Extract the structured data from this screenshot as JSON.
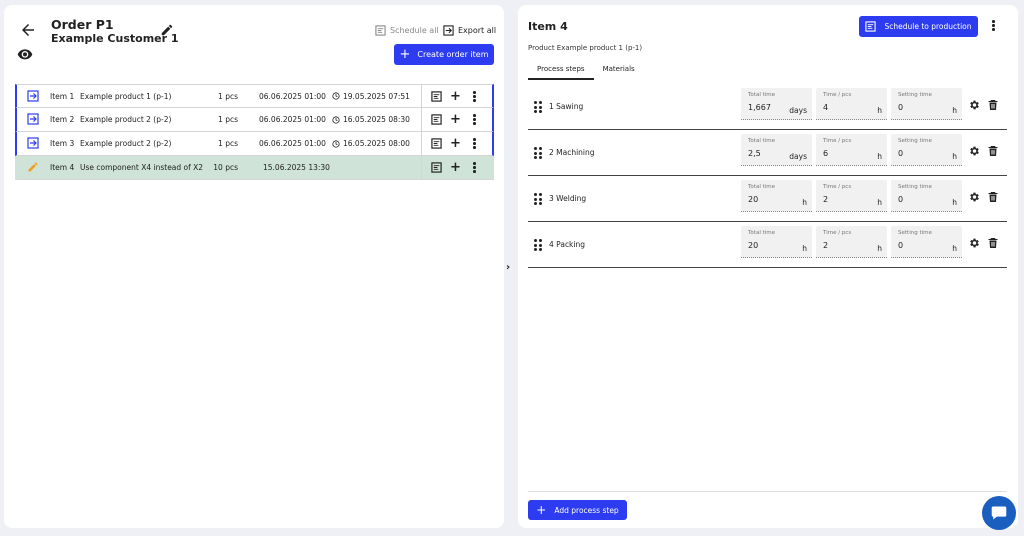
{
  "order": {
    "title": "Order P1",
    "customer": "Example Customer 1",
    "schedule_all_label": "Schedule all",
    "export_all_label": "Export all",
    "create_item_label": "Create order item"
  },
  "items": [
    {
      "name": "Item 1",
      "description": "Example product 1 (p-1)",
      "qty": "1 pcs",
      "date1": "06.06.2025 01:00",
      "date2": "19.05.2025 07:51"
    },
    {
      "name": "Item 2",
      "description": "Example product 2 (p-2)",
      "qty": "1 pcs",
      "date1": "06.06.2025 01:00",
      "date2": "16.05.2025 08:30"
    },
    {
      "name": "Item 3",
      "description": "Example product 2 (p-2)",
      "qty": "1 pcs",
      "date1": "06.06.2025 01:00",
      "date2": "16.05.2025 08:00"
    },
    {
      "name": "Item 4",
      "description": "Use component X4 instead of X2",
      "qty": "10 pcs",
      "date1": "15.06.2025 13:30",
      "date2": ""
    }
  ],
  "detail": {
    "title": "Item 4",
    "schedule_label": "Schedule to production",
    "product_line": "Product Example product 1 (p-1)",
    "tabs": [
      "Process steps",
      "Materials"
    ],
    "field_labels": {
      "total": "Total time",
      "per_pcs": "Time / pcs",
      "setting": "Setting time"
    },
    "steps": [
      {
        "name": "1 Sawing",
        "total": "1,667",
        "total_unit": "days",
        "per_pcs": "4",
        "per_pcs_unit": "h",
        "setting": "0",
        "setting_unit": "h"
      },
      {
        "name": "2 Machining",
        "total": "2,5",
        "total_unit": "days",
        "per_pcs": "6",
        "per_pcs_unit": "h",
        "setting": "0",
        "setting_unit": "h"
      },
      {
        "name": "3 Welding",
        "total": "20",
        "total_unit": "h",
        "per_pcs": "2",
        "per_pcs_unit": "h",
        "setting": "0",
        "setting_unit": "h"
      },
      {
        "name": "4 Packing",
        "total": "20",
        "total_unit": "h",
        "per_pcs": "2",
        "per_pcs_unit": "h",
        "setting": "0",
        "setting_unit": "h"
      }
    ],
    "add_step_label": "Add process step"
  },
  "colors": {
    "accent": "#2d3cf0",
    "active_row": "#cfe3d8",
    "chat": "#1a5fc0"
  },
  "icons": {
    "back": "arrow-left-icon",
    "edit": "pencil-icon",
    "view": "eye-icon",
    "schedule": "schedule-icon",
    "export": "export-icon",
    "item": "login-arrow-icon",
    "active_item": "pencil-icon",
    "add": "plus-icon",
    "more": "kebab-menu-icon",
    "clock": "clock-icon",
    "collapse": "chevron-right-icon",
    "drag": "drag-handle-icon",
    "settings": "gear-icon",
    "delete": "trash-icon",
    "chat": "chat-icon"
  }
}
